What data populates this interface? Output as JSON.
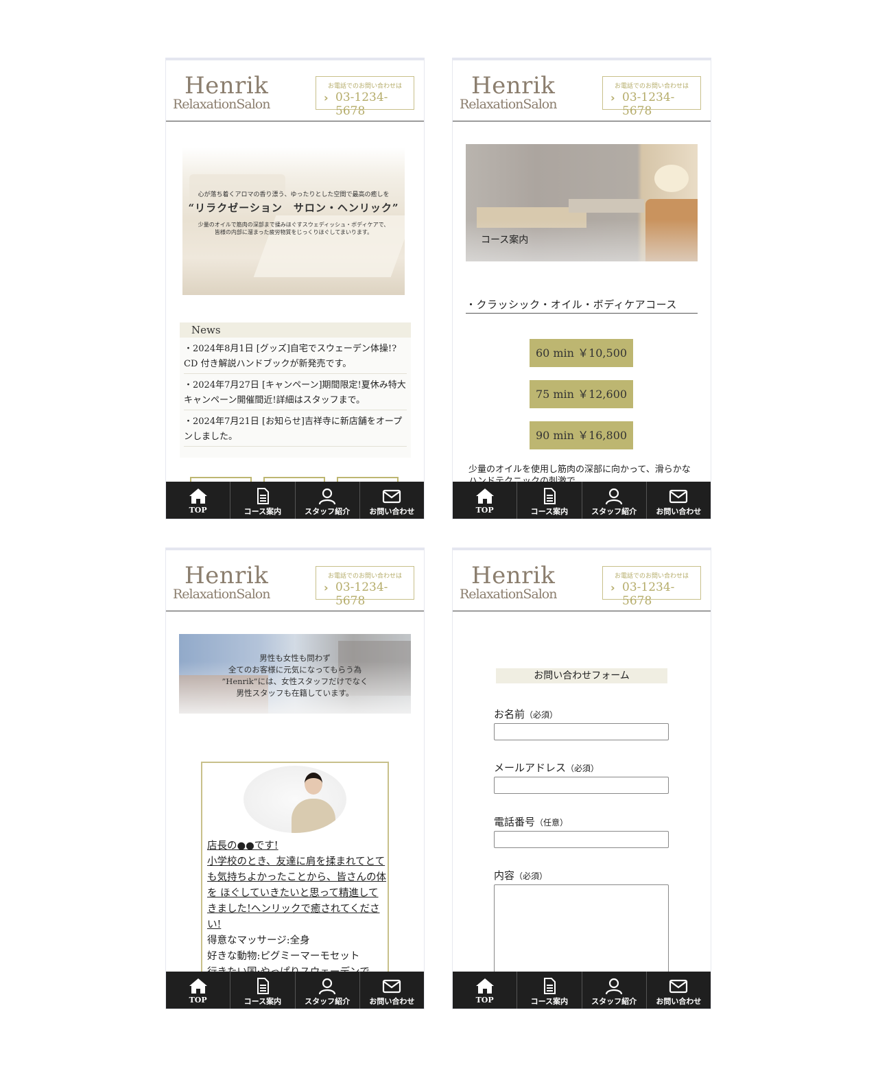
{
  "brand": {
    "logo_main": "Henrik",
    "logo_sub": "RelaxationSalon",
    "tel_caption": "お電話でのお問い合わせは",
    "tel_number": "03-1234-5678"
  },
  "nav": [
    {
      "label": "TOP",
      "icon": "home-icon"
    },
    {
      "label": "コース案内",
      "icon": "document-icon"
    },
    {
      "label": "スタッフ紹介",
      "icon": "user-icon"
    },
    {
      "label": "お問い合わせ",
      "icon": "mail-icon"
    }
  ],
  "home": {
    "hero_line1": "心が落ち着くアロマの香り漂う、ゆったりとした空間で最高の癒しを",
    "hero_title": "“リラクゼーション　サロン・ヘンリック”",
    "hero_line3a": "少量のオイルで筋肉の深部まで揉みほぐすスウェディッシュ・ボディケアで、",
    "hero_line3b": "皆様の内部に溜まった疲労物質をじっくりほぐしてまいります。",
    "news_title": "News",
    "news": [
      "・2024年8月1日 [グッズ]自宅でスウェーデン体操!?CD 付き解説ハンドブックが新発売です。",
      "・2024年7月27日 [キャンペーン]期間限定!夏休み特大キャンペーン開催間近!詳細はスタッフまで。",
      "・2024年7月21日 [お知らせ]吉祥寺に新店舗をオープンしました。"
    ]
  },
  "course": {
    "image_caption": "コース案内",
    "title": "・クラッシック・オイル・ボディケアコース",
    "prices": [
      "60 min ￥10,500",
      "75 min ￥12,600",
      "90 min ￥16,800"
    ],
    "description": "少量のオイルを使用し筋肉の深部に向かって、滑らかなハンドテクニックの刺激で"
  },
  "staff": {
    "banner_lines": [
      "男性も女性も問わず",
      "全てのお客様に元気になってもらう為",
      "”Henrik”には、女性スタッフだけでなく",
      "男性スタッフも在籍しています。"
    ],
    "bio_linked": "店長の●●です!",
    "bio_linked2": "小学校のとき、友達に肩を揉まれてとても気持ちよかったことから、皆さんの体を ほぐしていきたいと思って精進してきました!ヘンリックで癒されてください!",
    "bio_massage": "得意なマッサージ:全身",
    "bio_animal": "好きな動物:ピグミーマーモセット",
    "bio_country": "行きたい国:やっぱりスウェーデンで"
  },
  "contact": {
    "form_title": "お問い合わせフォーム",
    "fields": [
      {
        "label": "お名前",
        "note": "（必須）"
      },
      {
        "label": "メールアドレス",
        "note": "（必須）"
      },
      {
        "label": "電話番号",
        "note": "（任意）"
      },
      {
        "label": "内容",
        "note": "（必須）"
      }
    ]
  }
}
